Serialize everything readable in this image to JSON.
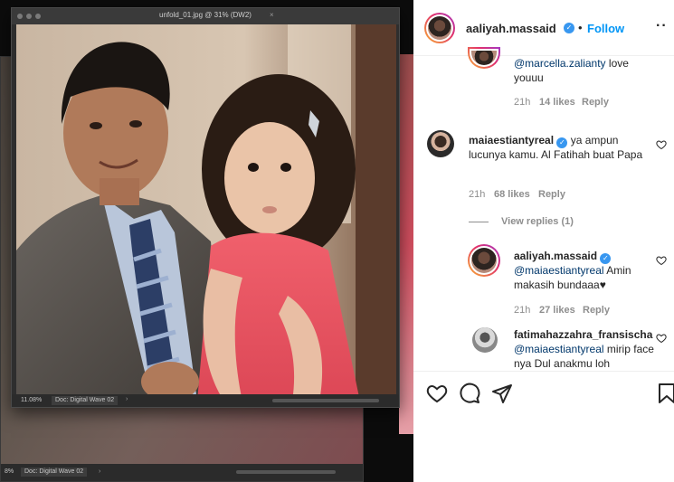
{
  "editor": {
    "window_title": "unfold_01.jpg @ 31% (DW2)",
    "title_close": "×",
    "zoom": "11.08%",
    "doc_label": "Doc: Digital Wave 02",
    "bg_zoom": "8%",
    "bg_doc_label": "Doc: Digital Wave 02",
    "arrow": "›"
  },
  "post": {
    "username": "aaliyah.massaid",
    "separator": "•",
    "follow_label": "Follow",
    "more": "··"
  },
  "comments": [
    {
      "user": "",
      "mention": "@marcella.zalianty",
      "text": " love youuu",
      "time": "21h",
      "likes": "14 likes",
      "reply": "Reply"
    },
    {
      "user": "maiaestiantyreal",
      "mention": "",
      "text": "ya ampun lucunya kamu. Al Fatihah buat Papa",
      "time": "21h",
      "likes": "68 likes",
      "reply": "Reply"
    }
  ],
  "view_replies": "View replies (1)",
  "replies": [
    {
      "user": "aaliyah.massaid",
      "mention": "@maiaestiantyreal",
      "text": " Amin makasih bundaaa♥",
      "time": "21h",
      "likes": "27 likes",
      "reply": "Reply"
    },
    {
      "user": "fatimahazzahra_fransischa",
      "mention": "@maiaestiantyreal",
      "text": " mirip face nya Dul anakmu loh"
    }
  ],
  "icons": [
    "heart-icon",
    "comment-icon",
    "share-icon",
    "bookmark-icon",
    "verified-icon"
  ],
  "colors": {
    "accent": "#0095f6",
    "verified": "#3897f0",
    "mention": "#00376b",
    "muted": "#8e8e8e"
  }
}
